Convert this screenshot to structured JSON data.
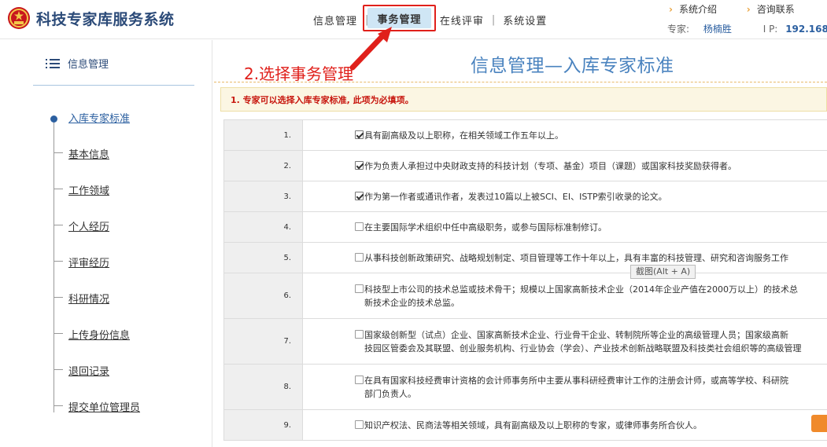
{
  "header": {
    "app_title": "科技专家库服务系统",
    "nav": [
      {
        "label": "信息管理"
      },
      {
        "label": "事务管理"
      },
      {
        "label": "在线评审"
      },
      {
        "label": "系统设置"
      }
    ],
    "nav_separator": "|",
    "top_links": [
      {
        "label": "系统介绍"
      },
      {
        "label": "咨询联系"
      }
    ],
    "user": {
      "expert_label": "专家:",
      "expert_name": "杨楠胜",
      "ip_label": "I P:",
      "ip_value": "192.168."
    }
  },
  "annotation": {
    "text": "2.选择事务管理",
    "color": "#e0201b"
  },
  "sidebar": {
    "header": "信息管理",
    "items": [
      {
        "label": "入库专家标准",
        "active": true
      },
      {
        "label": "基本信息"
      },
      {
        "label": "工作领域"
      },
      {
        "label": "个人经历"
      },
      {
        "label": "评审经历"
      },
      {
        "label": "科研情况"
      },
      {
        "label": "上传身份信息"
      },
      {
        "label": "退回记录"
      },
      {
        "label": "提交单位管理员"
      }
    ]
  },
  "main": {
    "title": "信息管理—入库专家标准",
    "notice": "1. 专家可以选择入库专家标准, 此项为必填项。",
    "criteria": [
      {
        "num": "1.",
        "checked": true,
        "lines": [
          "具有副高级及以上职称，在相关领域工作五年以上。"
        ]
      },
      {
        "num": "2.",
        "checked": true,
        "lines": [
          "作为负责人承担过中央财政支持的科技计划（专项、基金）项目（课题）或国家科技奖励获得者。"
        ]
      },
      {
        "num": "3.",
        "checked": true,
        "lines": [
          "作为第一作者或通讯作者，发表过10篇以上被SCI、EI、ISTP索引收录的论文。"
        ]
      },
      {
        "num": "4.",
        "checked": false,
        "lines": [
          "在主要国际学术组织中任中高级职务，或参与国际标准制修订。"
        ]
      },
      {
        "num": "5.",
        "checked": false,
        "lines": [
          "从事科技创新政策研究、战略规划制定、项目管理等工作十年以上，具有丰富的科技管理、研究和咨询服务工作"
        ]
      },
      {
        "num": "6.",
        "checked": false,
        "lines": [
          "科技型上市公司的技术总监或技术骨干；规模以上国家高新技术企业（2014年企业产值在2000万以上）的技术总",
          "新技术企业的技术总监。"
        ]
      },
      {
        "num": "7.",
        "checked": false,
        "lines": [
          "国家级创新型（试点）企业、国家高新技术企业、行业骨干企业、转制院所等企业的高级管理人员；国家级高新",
          "技园区管委会及其联盟、创业服务机构、行业协会（学会）、产业技术创新战略联盟及科技类社会组织等的高级管理"
        ]
      },
      {
        "num": "8.",
        "checked": false,
        "lines": [
          "在具有国家科技经费审计资格的会计师事务所中主要从事科研经费审计工作的注册会计师，或高等学校、科研院",
          "部门负责人。"
        ]
      },
      {
        "num": "9.",
        "checked": false,
        "lines": [
          "知识产权法、民商法等相关领域，具有副高级及以上职称的专家，或律师事务所合伙人。"
        ]
      }
    ]
  },
  "tooltip": "截图(Alt + A)",
  "colors": {
    "brand_blue": "#2b4a78",
    "title_blue": "#4a83bf",
    "highlight_tab": "#cfe6f5",
    "notice_red": "#c7160e"
  }
}
